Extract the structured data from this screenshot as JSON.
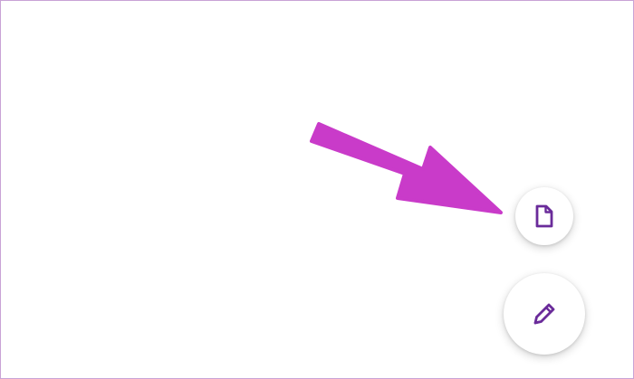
{
  "colors": {
    "arrow": "#c93bc9",
    "icon": "#6a2b9a",
    "fab_background": "#ffffff",
    "frame_border": "#c9a3d6"
  },
  "icons": {
    "small_fab": "document-icon",
    "large_fab": "pencil-icon",
    "annotation": "pointer-arrow"
  }
}
